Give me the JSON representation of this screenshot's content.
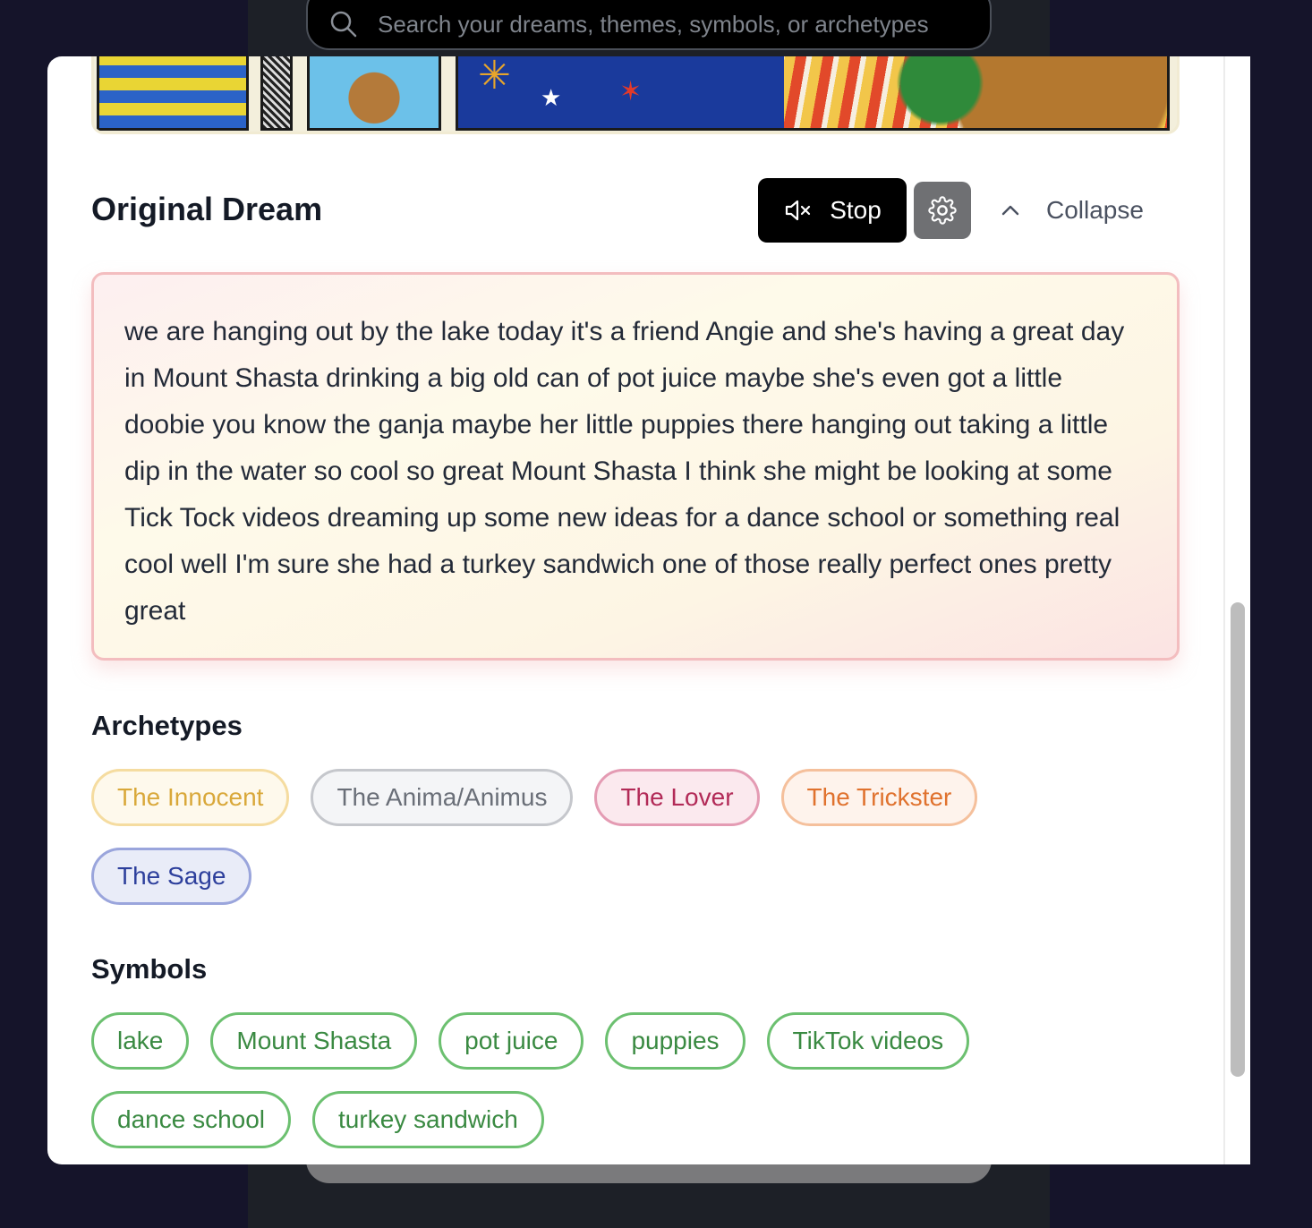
{
  "search": {
    "placeholder": "Search your dreams, themes, symbols, or archetypes"
  },
  "dream": {
    "section_title": "Original Dream",
    "stop_label": "Stop",
    "collapse_label": "Collapse",
    "text": "we are hanging out by the lake today it's a friend Angie and she's having a great day in Mount Shasta drinking a big old can of pot juice maybe she's even got a little doobie you know the ganja maybe her little puppies there hanging out taking a little dip in the water so cool so great Mount Shasta I think she might be looking at some Tick Tock videos dreaming up some new ideas for a dance school or something real cool well I'm sure she had a turkey sandwich one of those really perfect ones pretty great"
  },
  "archetypes": {
    "title": "Archetypes",
    "items": [
      {
        "label": "The Innocent",
        "color": "#d9a83a"
      },
      {
        "label": "The Anima/Animus",
        "color": "#6a6f78"
      },
      {
        "label": "The Lover",
        "color": "#b22a57"
      },
      {
        "label": "The Trickster",
        "color": "#e0722e"
      },
      {
        "label": "The Sage",
        "color": "#2d3f9c"
      }
    ]
  },
  "symbols": {
    "title": "Symbols",
    "color": "#3a8a42",
    "items": [
      "lake",
      "Mount Shasta",
      "pot juice",
      "puppies",
      "TikTok videos",
      "dance school",
      "turkey sandwich"
    ]
  },
  "icons": {
    "search": "search-icon",
    "mute": "speaker-muted-icon",
    "settings": "gear-icon",
    "collapse": "chevron-up-icon"
  }
}
